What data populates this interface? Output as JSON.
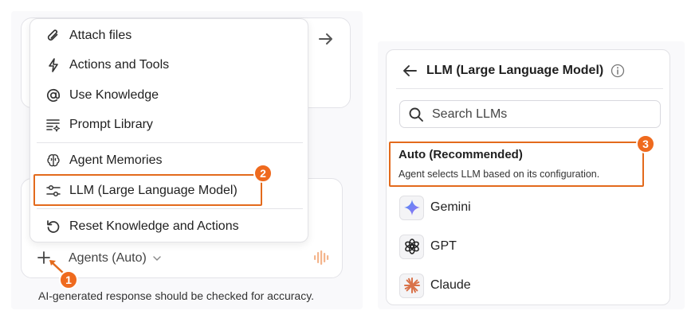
{
  "menu": {
    "items": [
      {
        "label": "Attach files",
        "icon": "paperclip-icon"
      },
      {
        "label": "Actions and Tools",
        "icon": "lightning-icon"
      },
      {
        "label": "Use Knowledge",
        "icon": "at-sign-icon"
      },
      {
        "label": "Prompt Library",
        "icon": "prompt-library-icon"
      },
      {
        "label": "Agent Memories",
        "icon": "brain-icon"
      },
      {
        "label": "LLM (Large Language Model)",
        "icon": "sliders-icon"
      },
      {
        "label": "Reset Knowledge and Actions",
        "icon": "reset-icon"
      }
    ]
  },
  "composer": {
    "agent_select_label": "Agents (Auto)",
    "disclaimer": "AI-generated response should be checked for accuracy."
  },
  "llm_panel": {
    "title": "LLM (Large Language Model)",
    "search_placeholder": "Search LLMs",
    "auto_option": {
      "title": "Auto (Recommended)",
      "description": "Agent selects LLM based on its configuration."
    },
    "models": [
      {
        "label": "Gemini",
        "icon": "gemini-icon"
      },
      {
        "label": "GPT",
        "icon": "openai-icon"
      },
      {
        "label": "Claude",
        "icon": "claude-icon"
      }
    ]
  },
  "callouts": {
    "one": "1",
    "two": "2",
    "three": "3"
  },
  "colors": {
    "highlight": "#e36a1c",
    "badge": "#ef6a1e",
    "card_border": "#e3e3e8"
  }
}
